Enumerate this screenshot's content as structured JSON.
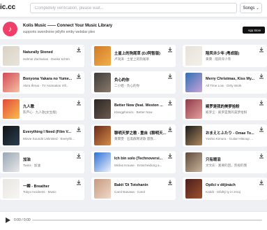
{
  "header": {
    "logo": "ic.cc",
    "search_placeholder": "Completely verification, please wait...",
    "songs_label": "Songs",
    "chevron": "⌄"
  },
  "banner": {
    "title": "Kolis Music —— Connect Your Music Library",
    "subtitle": "supports swordnone jellyfin emby webdav plex",
    "appstore_label": "App Store"
  },
  "songs": [
    {
      "title": "Naturally Stoned",
      "artist": "Helmut Zacharias · Danke schön",
      "thumb": [
        "#d9d2c6",
        "#e9e4da"
      ]
    },
    {
      "title": "土星上的狗尾草 (DJ阿智版)",
      "artist": "卢润泽 · 土星上的狗尾草",
      "thumb": [
        "#d07a2a",
        "#f2b04a"
      ]
    },
    {
      "title": "陪风许少年 (粤成版)",
      "artist": "黄霄 · 陪风许少年",
      "thumb": [
        "#e6e2da",
        "#f4f1ea"
      ]
    },
    {
      "title": "Bonyona Yakara no Yume...",
      "artist": "Akira Ifenai · TV Animation Vill...",
      "thumb": [
        "#d24a5a",
        "#f7c1a0"
      ]
    },
    {
      "title": "负心的你",
      "artist": "二小姐 · 负心的你",
      "thumb": [
        "#3f3c3a",
        "#8a7a6c"
      ]
    },
    {
      "title": "Merry Christmas, Kiss My...",
      "artist": "All Time Low · Dirty Work",
      "thumb": [
        "#2f6fb5",
        "#c9a3d8"
      ]
    },
    {
      "title": "九人歌",
      "artist": "陈芦心 · 九人歌(女生版)",
      "thumb": [
        "#e14b3b",
        "#fbbd4a"
      ]
    },
    {
      "title": "Better Now (feat. Weston ...",
      "artist": "Klangphonics · Better Now",
      "thumb": [
        "#2b2623",
        "#6b5b4f"
      ]
    },
    {
      "title": "殿罗是我的美梦拾粉",
      "artist": "殿罗尘 · 殿罗是我的美梦拾粉",
      "thumb": [
        "#8f3a4a",
        "#e6a19c"
      ]
    },
    {
      "title": "Everything I Need (Film V...",
      "artist": "Movie Sounds Unlimited · Everything...",
      "thumb": [
        "#111315",
        "#2c3e50"
      ]
    },
    {
      "title": "聊明天梦之歌 - 重自《聊明天...",
      "artist": "黄霄雯 · 石黑群网诗歌 雷我...",
      "thumb": [
        "#6a2b1c",
        "#d58c48"
      ]
    },
    {
      "title": "おまえとふたり - Omae To...",
      "artist": "Yoshio Kimura · Guitar Hitsoup ...",
      "thumb": [
        "#1a1a1a",
        "#b08a60"
      ]
    },
    {
      "title": "加油",
      "artist": "Twins · 加油",
      "thumb": [
        "#9aa6b5",
        "#e8e8e8"
      ]
    },
    {
      "title": "Ich bin solo (Technoversi...",
      "artist": "Mickie Krause · Entscheidung a...",
      "thumb": [
        "#2c6fd6",
        "#f0f4fa"
      ]
    },
    {
      "title": "只有眼泪",
      "artist": "文文彩 · 素要的回，凯视的我",
      "thumb": [
        "#5f4a3c",
        "#c8b59a"
      ]
    },
    {
      "title": "一瞬 - Breather",
      "artist": "Tokyo Incidents · Music",
      "thumb": [
        "#e8e6e2",
        "#f7f6f3"
      ]
    },
    {
      "title": "Bakit 'Di Totohanin",
      "artist": "Carol Banawa · Carol",
      "thumb": [
        "#c69a80",
        "#f0d8c8"
      ]
    },
    {
      "title": "Opilci v dějinách",
      "artist": "Kabát · Dědký ty in zmaj",
      "thumb": [
        "#4a1e1e",
        "#a0522d"
      ]
    }
  ],
  "player": {
    "time": "0:00 / 0:00",
    "progress": 0
  }
}
